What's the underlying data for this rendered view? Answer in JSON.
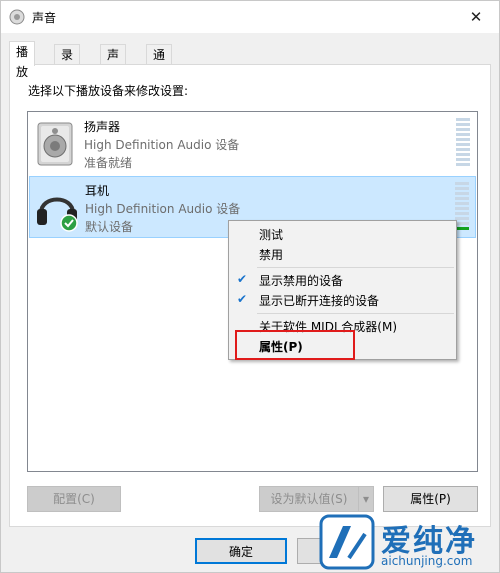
{
  "window": {
    "title": "声音",
    "close_glyph": "✕"
  },
  "tabs": [
    {
      "label": "播放",
      "active": true
    },
    {
      "label": "录制",
      "active": false
    },
    {
      "label": "声音",
      "active": false
    },
    {
      "label": "通信",
      "active": false
    }
  ],
  "instruction": "选择以下播放设备来修改设置:",
  "devices": [
    {
      "name": "扬声器",
      "driver": "High Definition Audio 设备",
      "status": "准备就绪",
      "icon": "speaker-icon",
      "selected": false,
      "level": 0.0
    },
    {
      "name": "耳机",
      "driver": "High Definition Audio 设备",
      "status": "默认设备",
      "icon": "headphones-icon",
      "selected": true,
      "default_badge_icon": "check-badge-icon",
      "level": 0.1
    }
  ],
  "context_menu": {
    "items": [
      {
        "label": "测试",
        "checked": false
      },
      {
        "label": "禁用",
        "checked": false
      },
      {
        "label": "显示禁用的设备",
        "checked": true
      },
      {
        "label": "显示已断开连接的设备",
        "checked": true
      },
      {
        "label": "关于软件 MIDI 合成器(M)",
        "checked": false
      },
      {
        "label": "属性(P)",
        "checked": false,
        "bold": true
      }
    ],
    "check_glyph": "✔"
  },
  "buttons": {
    "configure": "配置(C)",
    "set_default": "设为默认值(S)",
    "set_default_arrow": "▾",
    "properties": "属性(P)",
    "ok": "确定"
  },
  "watermark": {
    "text": "爱纯净",
    "url": "aichunjing.com"
  },
  "colors": {
    "selection": "#cce8ff",
    "highlight_box": "#e01b1b",
    "accent": "#0078d7"
  }
}
